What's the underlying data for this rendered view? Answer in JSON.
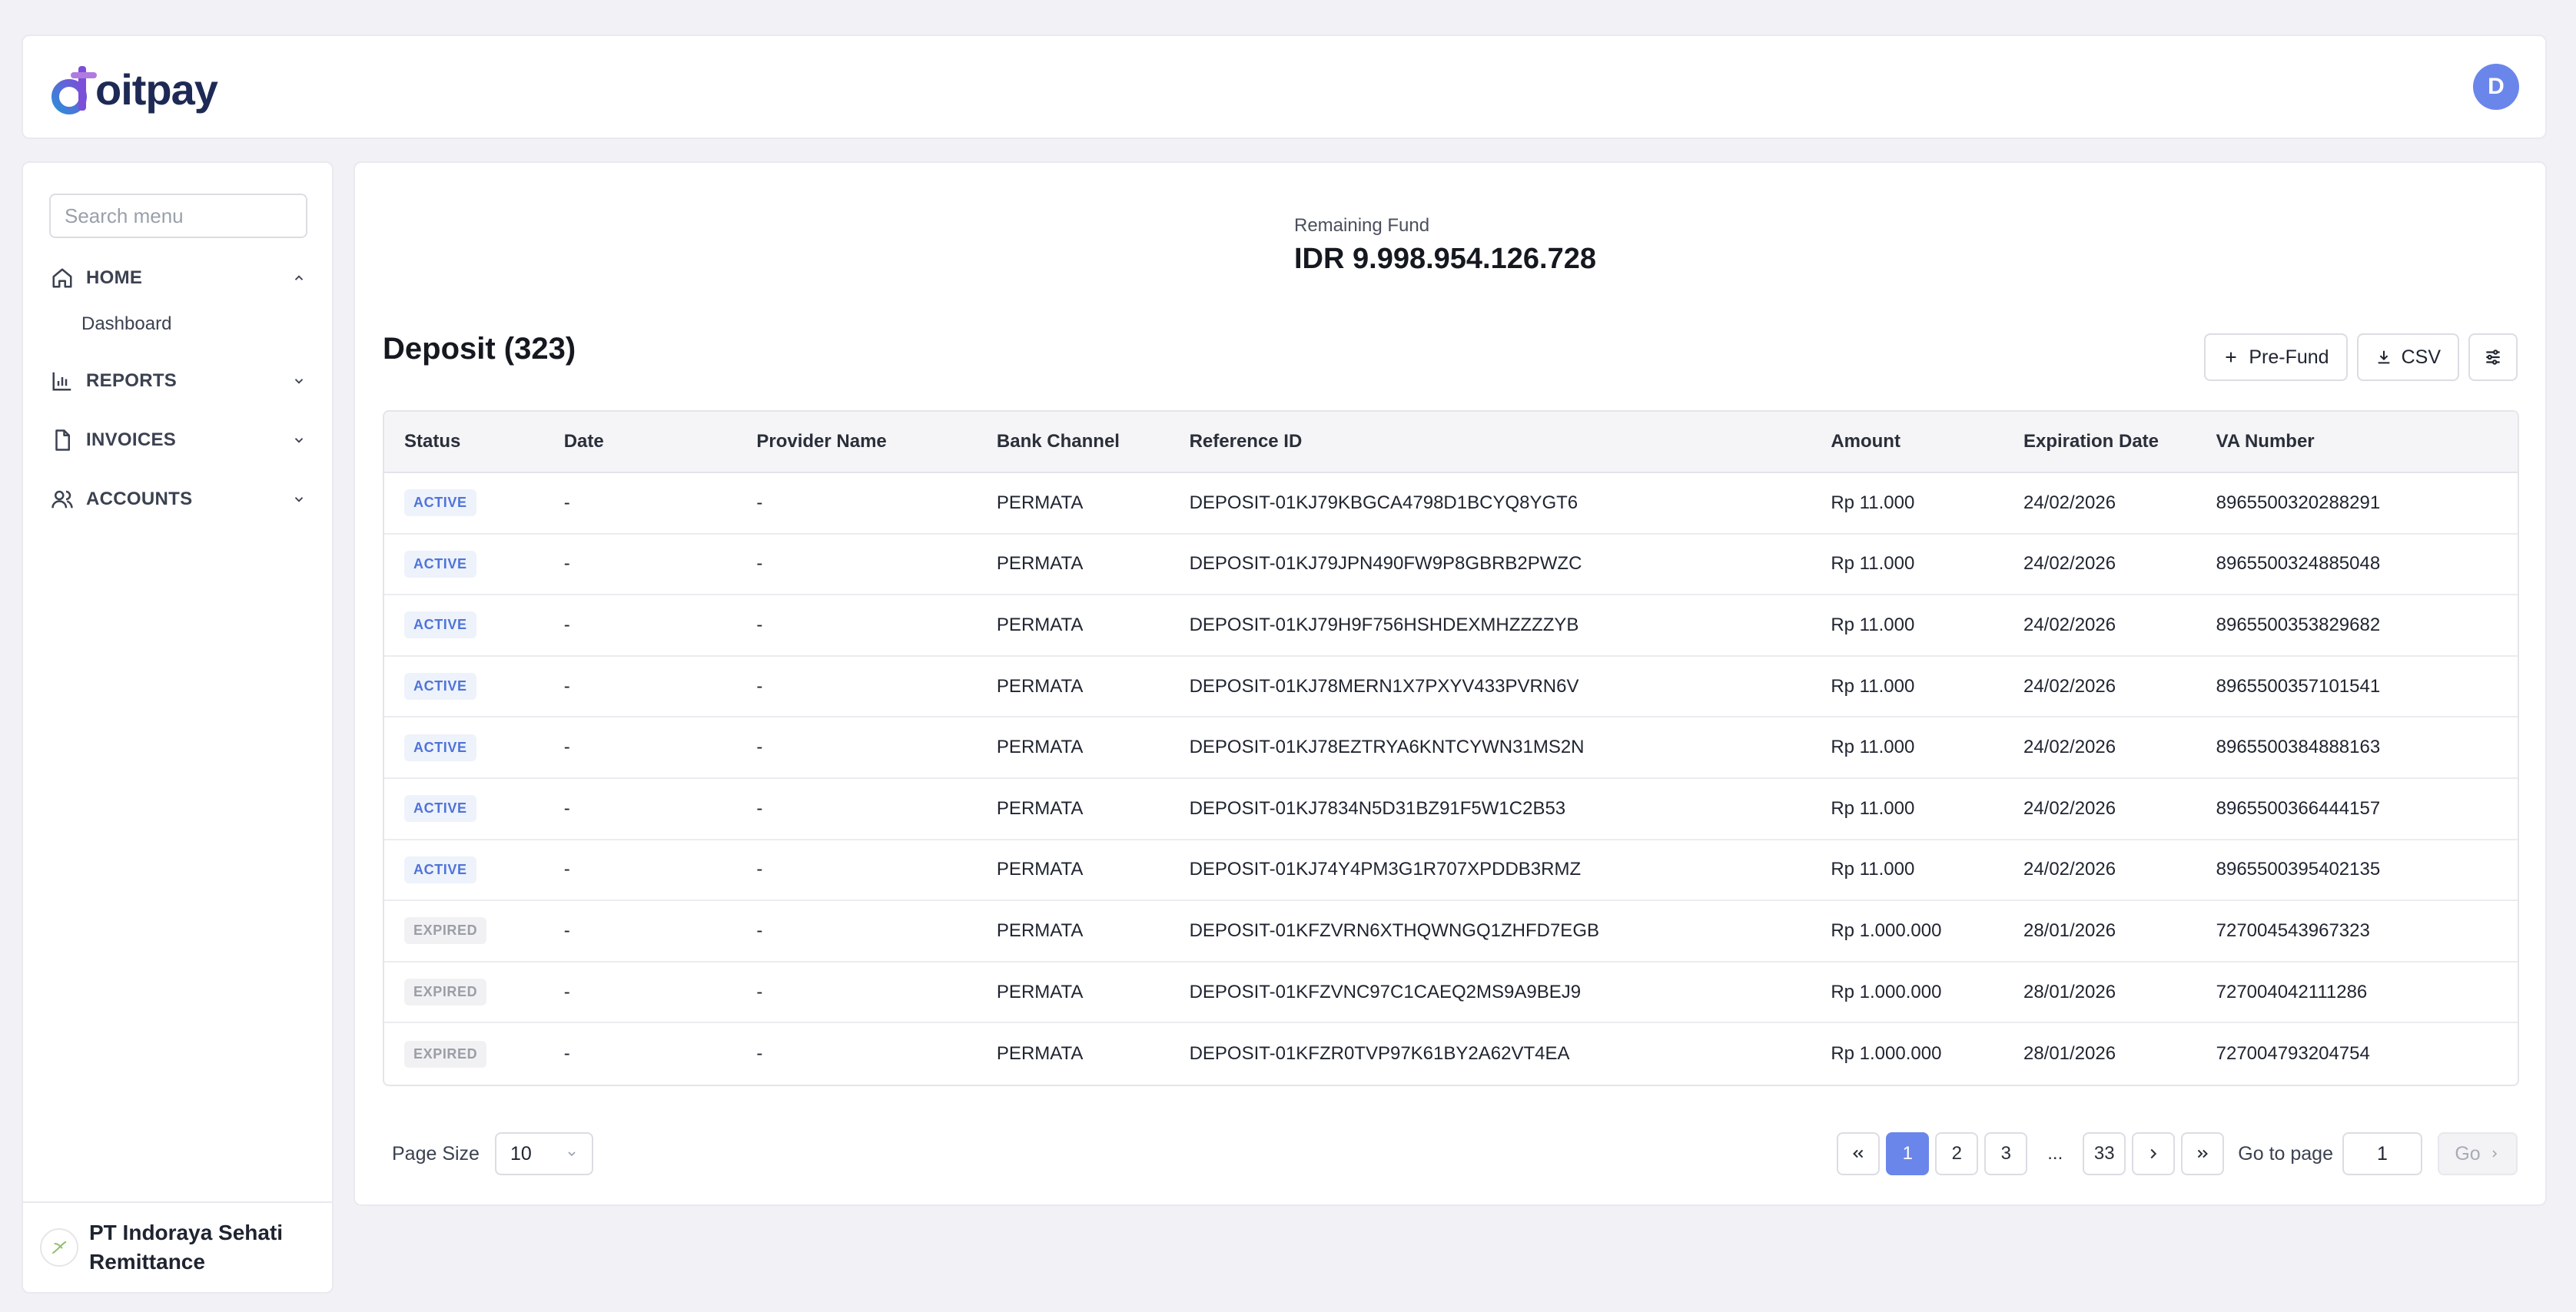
{
  "header": {
    "logo_text": "oitpay",
    "avatar_initial": "D"
  },
  "sidebar": {
    "search_placeholder": "Search menu",
    "items": [
      {
        "label": "HOME",
        "icon": "home-icon",
        "chevron": "chevron-up-icon"
      },
      {
        "label": "REPORTS",
        "icon": "bar-chart-icon",
        "chevron": "chevron-down-icon"
      },
      {
        "label": "INVOICES",
        "icon": "file-icon",
        "chevron": "chevron-down-icon"
      },
      {
        "label": "ACCOUNTS",
        "icon": "users-icon",
        "chevron": "chevron-down-icon"
      }
    ],
    "home_subitems": [
      {
        "label": "Dashboard"
      }
    ],
    "company": "PT Indoraya Sehati Remittance"
  },
  "main": {
    "fund_label": "Remaining Fund",
    "fund_value": "IDR 9.998.954.126.728",
    "title": "Deposit (323)",
    "toolbar": {
      "prefund_label": "Pre-Fund",
      "csv_label": "CSV"
    },
    "table": {
      "headers": [
        "Status",
        "Date",
        "Provider Name",
        "Bank Channel",
        "Reference ID",
        "Amount",
        "Expiration Date",
        "VA Number"
      ],
      "rows": [
        {
          "status": "ACTIVE",
          "date": "-",
          "provider": "-",
          "bank": "PERMATA",
          "ref": "DEPOSIT-01KJ79KBGCA4798D1BCYQ8YGT6",
          "amount": "Rp 11.000",
          "exp": "24/02/2026",
          "va": "8965500320288291"
        },
        {
          "status": "ACTIVE",
          "date": "-",
          "provider": "-",
          "bank": "PERMATA",
          "ref": "DEPOSIT-01KJ79JPN490FW9P8GBRB2PWZC",
          "amount": "Rp 11.000",
          "exp": "24/02/2026",
          "va": "8965500324885048"
        },
        {
          "status": "ACTIVE",
          "date": "-",
          "provider": "-",
          "bank": "PERMATA",
          "ref": "DEPOSIT-01KJ79H9F756HSHDEXMHZZZZYB",
          "amount": "Rp 11.000",
          "exp": "24/02/2026",
          "va": "8965500353829682"
        },
        {
          "status": "ACTIVE",
          "date": "-",
          "provider": "-",
          "bank": "PERMATA",
          "ref": "DEPOSIT-01KJ78MERN1X7PXYV433PVRN6V",
          "amount": "Rp 11.000",
          "exp": "24/02/2026",
          "va": "8965500357101541"
        },
        {
          "status": "ACTIVE",
          "date": "-",
          "provider": "-",
          "bank": "PERMATA",
          "ref": "DEPOSIT-01KJ78EZTRYA6KNTCYWN31MS2N",
          "amount": "Rp 11.000",
          "exp": "24/02/2026",
          "va": "8965500384888163"
        },
        {
          "status": "ACTIVE",
          "date": "-",
          "provider": "-",
          "bank": "PERMATA",
          "ref": "DEPOSIT-01KJ7834N5D31BZ91F5W1C2B53",
          "amount": "Rp 11.000",
          "exp": "24/02/2026",
          "va": "8965500366444157"
        },
        {
          "status": "ACTIVE",
          "date": "-",
          "provider": "-",
          "bank": "PERMATA",
          "ref": "DEPOSIT-01KJ74Y4PM3G1R707XPDDB3RMZ",
          "amount": "Rp 11.000",
          "exp": "24/02/2026",
          "va": "8965500395402135"
        },
        {
          "status": "EXPIRED",
          "date": "-",
          "provider": "-",
          "bank": "PERMATA",
          "ref": "DEPOSIT-01KFZVRN6XTHQWNGQ1ZHFD7EGB",
          "amount": "Rp 1.000.000",
          "exp": "28/01/2026",
          "va": "727004543967323"
        },
        {
          "status": "EXPIRED",
          "date": "-",
          "provider": "-",
          "bank": "PERMATA",
          "ref": "DEPOSIT-01KFZVNC97C1CAEQ2MS9A9BEJ9",
          "amount": "Rp 1.000.000",
          "exp": "28/01/2026",
          "va": "727004042111286"
        },
        {
          "status": "EXPIRED",
          "date": "-",
          "provider": "-",
          "bank": "PERMATA",
          "ref": "DEPOSIT-01KFZR0TVP97K61BY2A62VT4EA",
          "amount": "Rp 1.000.000",
          "exp": "28/01/2026",
          "va": "727004793204754"
        }
      ]
    },
    "pagination": {
      "page_size_label": "Page Size",
      "page_size_value": "10",
      "pages": [
        "1",
        "2",
        "3"
      ],
      "ellipsis": "...",
      "last_page": "33",
      "current_page": "1",
      "goto_label": "Go to page",
      "goto_value": "1",
      "go_label": "Go"
    }
  },
  "colors": {
    "accent": "#6b86ea",
    "active_badge": "#4f74d9",
    "expired_badge": "#9a9ea8"
  }
}
